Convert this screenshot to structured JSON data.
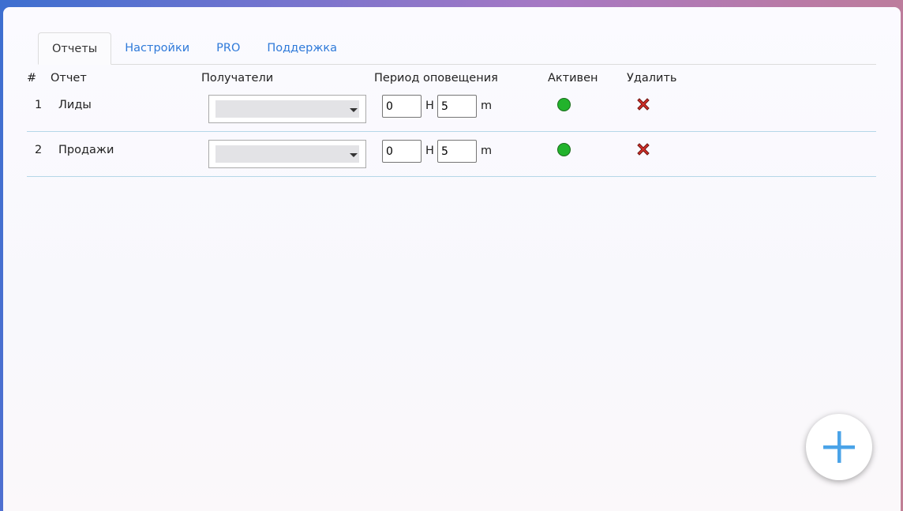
{
  "tabs": [
    {
      "label": "Отчеты",
      "active": true
    },
    {
      "label": "Настройки",
      "active": false
    },
    {
      "label": "PRO",
      "active": false
    },
    {
      "label": "Поддержка",
      "active": false
    }
  ],
  "table": {
    "headers": {
      "index": "#",
      "report": "Отчет",
      "recipients": "Получатели",
      "period": "Период оповещения",
      "active": "Активен",
      "delete": "Удалить"
    },
    "rows": [
      {
        "index": "1",
        "report": "Лиды",
        "hours": "0",
        "hours_unit": "H",
        "minutes": "5",
        "minutes_unit": "m"
      },
      {
        "index": "2",
        "report": "Продажи",
        "hours": "0",
        "hours_unit": "H",
        "minutes": "5",
        "minutes_unit": "m"
      }
    ]
  },
  "icons": {
    "active": "status-dot-icon",
    "delete": "red-x-icon",
    "add": "plus-icon",
    "select": "dropdown-caret-icon"
  },
  "colors": {
    "tab_link": "#2f7ad9",
    "active_dot": "#22b32c",
    "delete_x": "#d6302a",
    "add_plus": "#4aa3e8",
    "row_divider": "#b5d7e8"
  }
}
